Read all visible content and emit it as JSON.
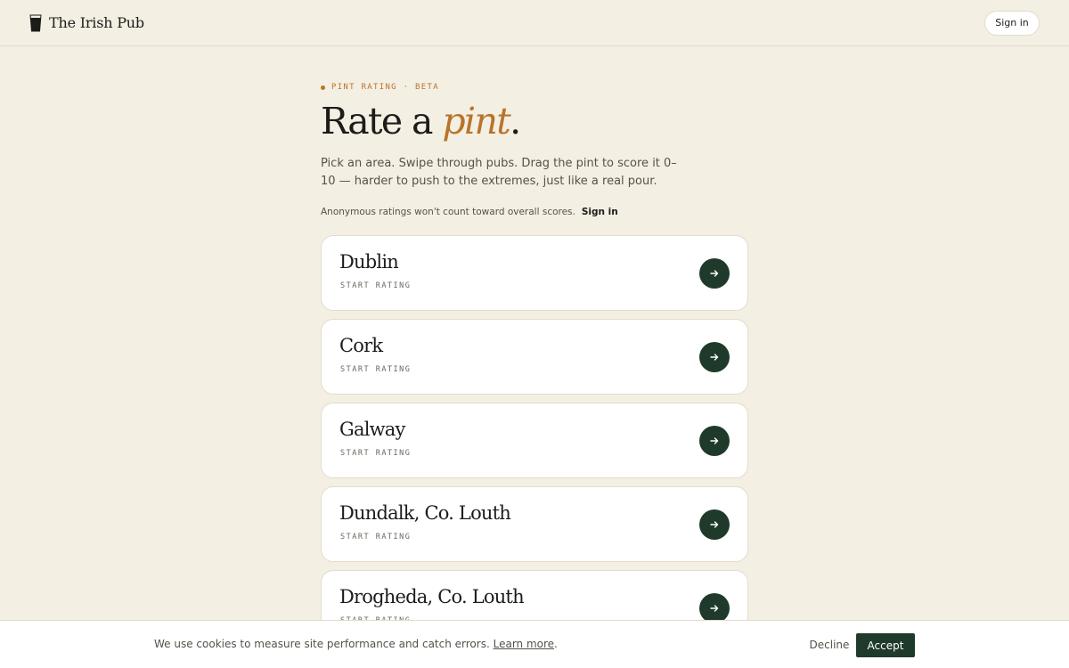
{
  "header": {
    "brand_name": "The Irish Pub",
    "brand_icon": "pint-glass-icon",
    "sign_in_label": "Sign in"
  },
  "hero": {
    "eyebrow": "PINT RATING · BETA",
    "title_prefix": "Rate a ",
    "title_accent": "pint",
    "title_suffix": ".",
    "lede": "Pick an area. Swipe through pubs. Drag the pint to score it 0–10 — harder to push to the extremes, just like a real pour.",
    "anon_note": "Anonymous ratings won't count toward overall scores.",
    "anon_sign_in": "Sign in"
  },
  "areas": [
    {
      "name": "Dublin",
      "action": "START RATING"
    },
    {
      "name": "Cork",
      "action": "START RATING"
    },
    {
      "name": "Galway",
      "action": "START RATING"
    },
    {
      "name": "Dundalk, Co. Louth",
      "action": "START RATING"
    },
    {
      "name": "Drogheda, Co. Louth",
      "action": "START RATING"
    }
  ],
  "cookie_banner": {
    "text": "We use cookies to measure site performance and catch errors.",
    "learn_more": "Learn more",
    "period": ".",
    "decline_label": "Decline",
    "accept_label": "Accept"
  },
  "colors": {
    "background": "#f4efe3",
    "accent": "#b8742a",
    "primary": "#1f3a2a",
    "card": "#ffffff"
  }
}
